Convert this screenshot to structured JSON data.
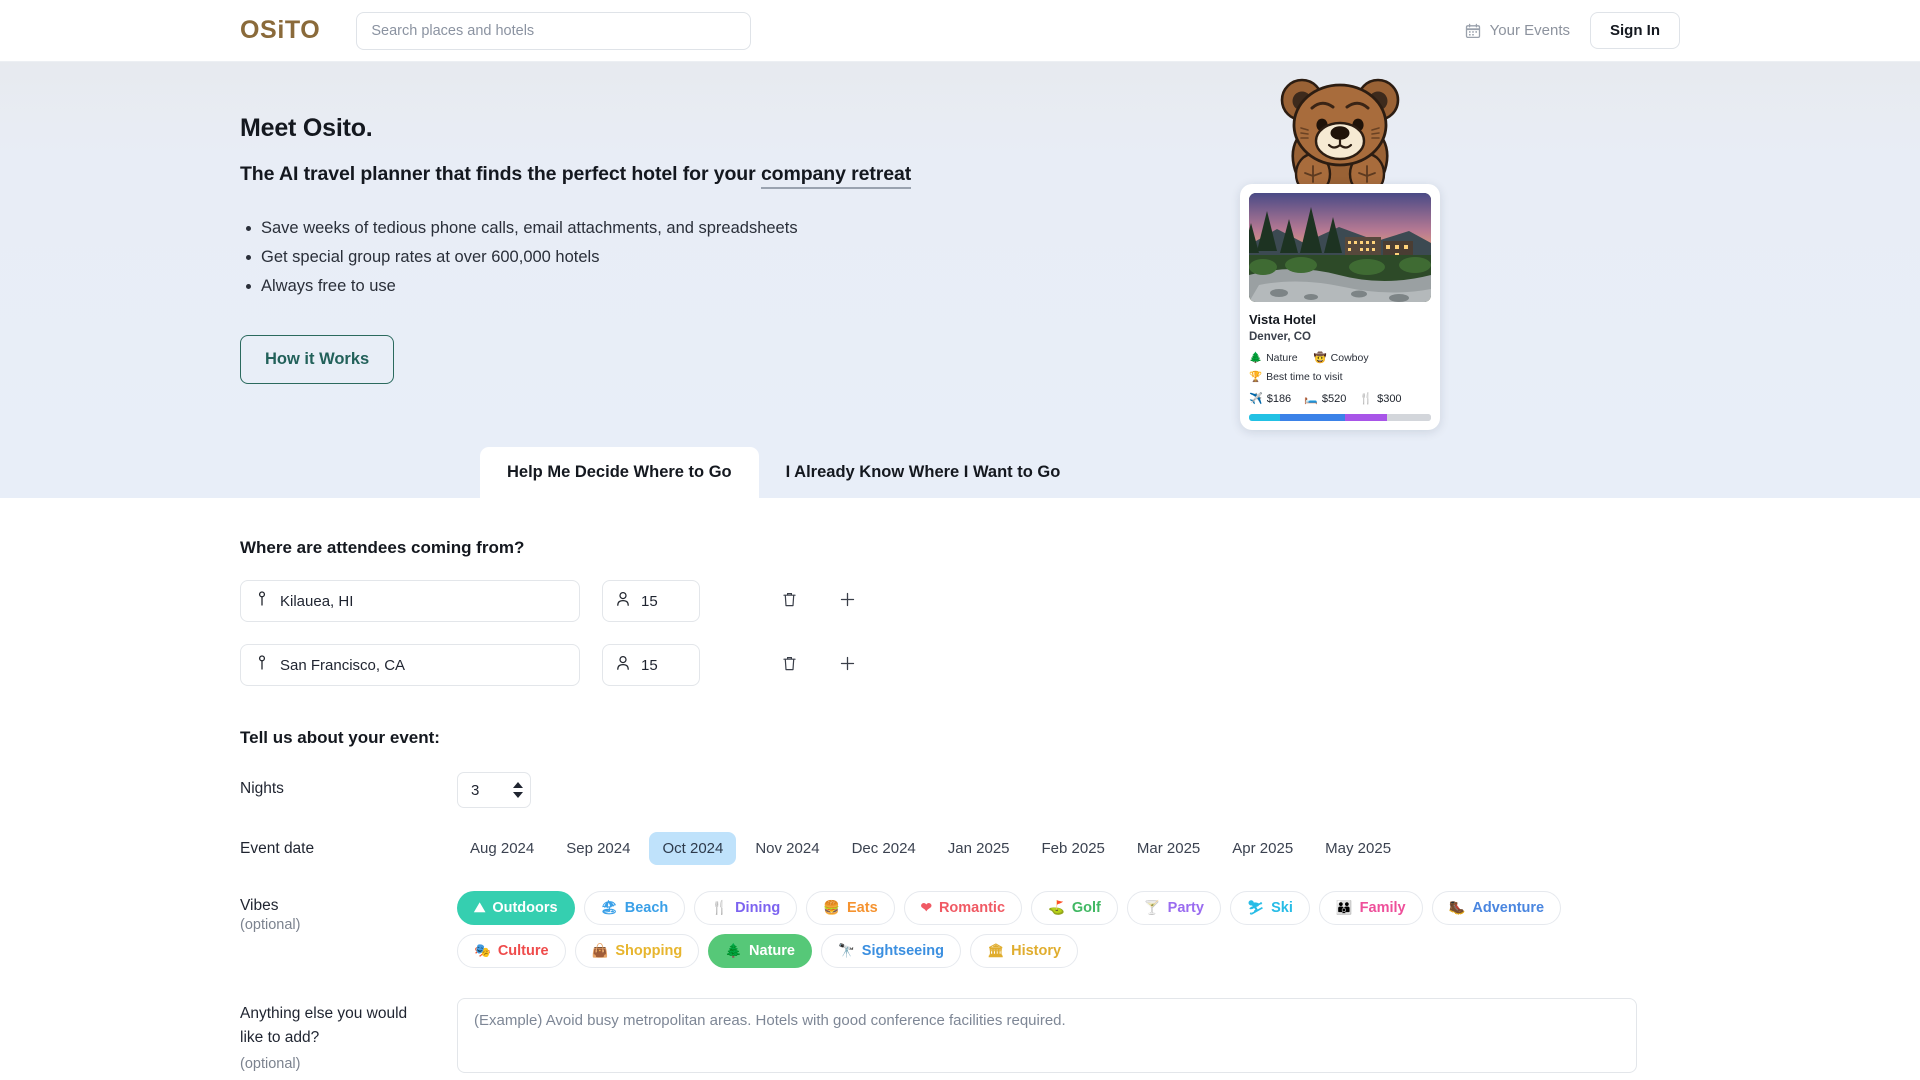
{
  "header": {
    "logo": "OSiTO",
    "search_placeholder": "Search places and hotels",
    "search_value": "",
    "your_events": "Your Events",
    "sign_in": "Sign In"
  },
  "hero": {
    "title": "Meet Osito.",
    "subtitle_prefix": "The AI travel planner that finds the perfect hotel for your ",
    "subtitle_highlight": "company retreat",
    "bullets": [
      "Save weeks of tedious phone calls, email attachments, and spreadsheets",
      "Get special group rates at over 600,000 hotels",
      "Always free to use"
    ],
    "how_it_works": "How it Works"
  },
  "hotel_card": {
    "name": "Vista Hotel",
    "location": "Denver, CO",
    "tags": [
      {
        "icon": "evergreen-tree-icon",
        "glyph": "🌲",
        "label": "Nature"
      },
      {
        "icon": "cowboy-hat-icon",
        "glyph": "🤠",
        "label": "Cowboy"
      }
    ],
    "best_time": {
      "icon": "trophy-icon",
      "glyph": "🏆",
      "label": "Best time to visit"
    },
    "prices": [
      {
        "icon": "airplane-icon",
        "glyph": "✈️",
        "value": "$186",
        "color": "#17b3e0"
      },
      {
        "icon": "bed-icon",
        "glyph": "🛏️",
        "value": "$520",
        "color": "#3b82e8"
      },
      {
        "icon": "cutlery-icon",
        "glyph": "🍴",
        "value": "$300",
        "color": "#a855e8"
      }
    ],
    "price_bar": [
      {
        "color": "#22c1e4",
        "pct": 17
      },
      {
        "color": "#3b82e8",
        "pct": 36
      },
      {
        "color": "#a855e8",
        "pct": 23
      },
      {
        "color": "#d3d6db",
        "pct": 24
      }
    ]
  },
  "tabs": [
    {
      "label": "Help Me Decide Where to Go",
      "active": true
    },
    {
      "label": "I Already Know Where I Want to Go",
      "active": false
    }
  ],
  "form": {
    "attendees_title": "Where are attendees coming from?",
    "locations": [
      {
        "city": "Kilauea, HI",
        "count": "15"
      },
      {
        "city": "San Francisco, CA",
        "count": "15"
      }
    ],
    "event_title": "Tell us about your event:",
    "nights_label": "Nights",
    "nights_value": "3",
    "event_date_label": "Event date",
    "months": [
      {
        "label": "Aug 2024",
        "active": false
      },
      {
        "label": "Sep 2024",
        "active": false
      },
      {
        "label": "Oct 2024",
        "active": true
      },
      {
        "label": "Nov 2024",
        "active": false
      },
      {
        "label": "Dec 2024",
        "active": false
      },
      {
        "label": "Jan 2025",
        "active": false
      },
      {
        "label": "Feb 2025",
        "active": false
      },
      {
        "label": "Mar 2025",
        "active": false
      },
      {
        "label": "Apr 2025",
        "active": false
      },
      {
        "label": "May 2025",
        "active": false
      }
    ],
    "vibes_label": "Vibes",
    "vibes_optional": "(optional)",
    "vibes": [
      {
        "label": "Outdoors",
        "icon": "mountain-icon",
        "glyph": "⛰",
        "color": "#2ecbab",
        "selected": true,
        "bg": "#35cfb0"
      },
      {
        "label": "Beach",
        "icon": "beach-icon",
        "glyph": "🏖",
        "color": "#3aa0e8",
        "selected": false
      },
      {
        "label": "Dining",
        "icon": "fork-knife-icon",
        "glyph": "🍴",
        "color": "#7c63f0",
        "selected": false
      },
      {
        "label": "Eats",
        "icon": "burger-icon",
        "glyph": "🍔",
        "color": "#f59330",
        "selected": false
      },
      {
        "label": "Romantic",
        "icon": "heart-icon",
        "glyph": "❤",
        "color": "#f05a64",
        "selected": false
      },
      {
        "label": "Golf",
        "icon": "golf-flag-icon",
        "glyph": "⛳",
        "color": "#41b863",
        "selected": false
      },
      {
        "label": "Party",
        "icon": "cocktail-icon",
        "glyph": "🍸",
        "color": "#9a6cf0",
        "selected": false
      },
      {
        "label": "Ski",
        "icon": "skier-icon",
        "glyph": "⛷",
        "color": "#27bce6",
        "selected": false
      },
      {
        "label": "Family",
        "icon": "family-icon",
        "glyph": "👪",
        "color": "#ee4f9a",
        "selected": false
      },
      {
        "label": "Adventure",
        "icon": "hiker-icon",
        "glyph": "🥾",
        "color": "#4a86e0",
        "selected": false
      },
      {
        "label": "Culture",
        "icon": "masks-icon",
        "glyph": "🎭",
        "color": "#ef4b4b",
        "selected": false
      },
      {
        "label": "Shopping",
        "icon": "shopping-bag-icon",
        "glyph": "👜",
        "color": "#e7b52e",
        "selected": false
      },
      {
        "label": "Nature",
        "icon": "tree-icon",
        "glyph": "🌲",
        "color": "#4cc46e",
        "selected": true,
        "bg": "#56c878"
      },
      {
        "label": "Sightseeing",
        "icon": "binoculars-icon",
        "glyph": "🔭",
        "color": "#3b8fe0",
        "selected": false
      },
      {
        "label": "History",
        "icon": "monument-icon",
        "glyph": "🏛",
        "color": "#e0ad2e",
        "selected": false
      }
    ],
    "notes_label_line1": "Anything else you would",
    "notes_label_line2": "like to add?",
    "notes_optional": "(optional)",
    "notes_placeholder": "(Example) Avoid busy metropolitan areas. Hotels with good conference facilities required.",
    "notes_value": ""
  },
  "colors": {
    "accent_teal": "#22615a",
    "month_active_bg": "#bfe2fb",
    "logo_brown": "#8a6a3a"
  }
}
